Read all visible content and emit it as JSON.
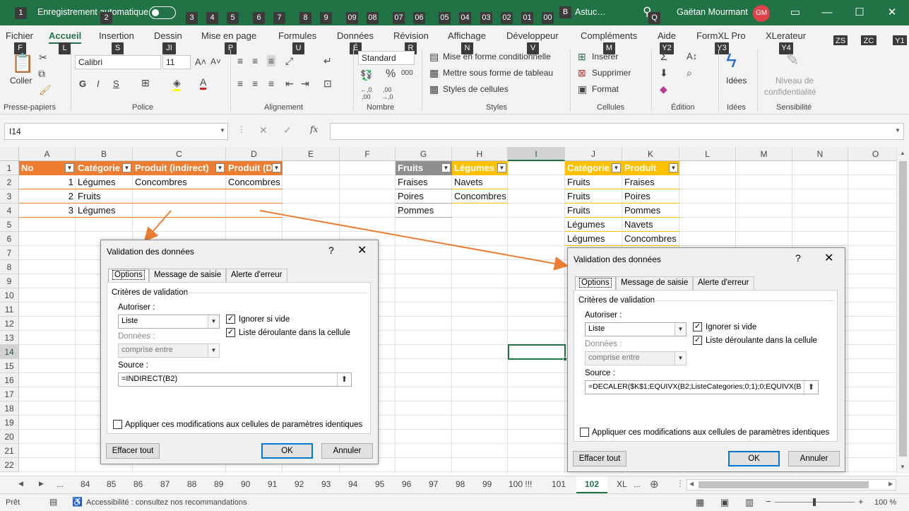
{
  "title_bar": {
    "autosave_label": "Enregistrement automatique",
    "qat_keys": [
      "1",
      "2",
      "3",
      "4",
      "5",
      "6",
      "7",
      "8",
      "9",
      "09",
      "08",
      "07",
      "06",
      "05",
      "04",
      "03",
      "02",
      "01",
      "00"
    ],
    "search_key": "B",
    "search_text": "Astuc…",
    "search_hint_key": "Q",
    "user_name": "Gaëtan Mourmant",
    "user_initials": "GM"
  },
  "tabs": [
    {
      "label": "Fichier",
      "key": "F"
    },
    {
      "label": "Accueil",
      "key": "L"
    },
    {
      "label": "Insertion",
      "key": "S"
    },
    {
      "label": "Dessin",
      "key": "JI"
    },
    {
      "label": "Mise en page",
      "key": "P"
    },
    {
      "label": "Formules",
      "key": "U"
    },
    {
      "label": "Données",
      "key": "É"
    },
    {
      "label": "Révision",
      "key": "R"
    },
    {
      "label": "Affichage",
      "key": "N"
    },
    {
      "label": "Développeur",
      "key": "V"
    },
    {
      "label": "Compléments",
      "key": "M"
    },
    {
      "label": "Aide",
      "key": "Y2"
    },
    {
      "label": "FormXL Pro",
      "key": "Y3"
    },
    {
      "label": "XLerateur",
      "key": "Y4"
    }
  ],
  "tab_extra_keys": [
    "ZS",
    "ZC",
    "Y1"
  ],
  "ribbon": {
    "clipboard": {
      "paste": "Coller",
      "group": "Presse-papiers"
    },
    "font": {
      "name": "Calibri",
      "size": "11",
      "bold": "G",
      "italic": "I",
      "underline": "S",
      "group": "Police"
    },
    "alignment": {
      "group": "Alignement"
    },
    "number": {
      "format": "Standard",
      "group": "Nombre"
    },
    "styles": {
      "conditional": "Mise en forme conditionnelle",
      "table": "Mettre sous forme de tableau",
      "cell_styles": "Styles de cellules",
      "group": "Styles"
    },
    "cells": {
      "insert": "Insérer",
      "delete": "Supprimer",
      "format": "Format",
      "group": "Cellules"
    },
    "editing": {
      "group": "Édition"
    },
    "ideas": {
      "label": "Idées",
      "group": "Idées"
    },
    "sensitivity": {
      "label1": "Niveau de",
      "label2": "confidentialité",
      "group": "Sensibilité"
    }
  },
  "formula_bar": {
    "name_box": "I14",
    "formula": "",
    "fx": "fx"
  },
  "columns": [
    "A",
    "B",
    "C",
    "D",
    "E",
    "F",
    "G",
    "H",
    "I",
    "J",
    "K",
    "L",
    "M",
    "N",
    "O"
  ],
  "rows": [
    "1",
    "2",
    "3",
    "4",
    "5",
    "6",
    "7",
    "8",
    "9",
    "10",
    "11",
    "12",
    "13",
    "14",
    "15",
    "16",
    "17",
    "18",
    "19",
    "20",
    "21",
    "22"
  ],
  "table1": {
    "headers": [
      "No",
      "Catégorie",
      "Produit (indirect)",
      "Produit (D"
    ],
    "rows": [
      [
        "1",
        "Légumes",
        "Concombres",
        "Concombres"
      ],
      [
        "2",
        "Fruits",
        "",
        ""
      ],
      [
        "3",
        "Légumes",
        "",
        ""
      ]
    ]
  },
  "table2": {
    "headers": [
      "Fruits",
      "Légumes"
    ],
    "rows": [
      [
        "Fraises",
        "Navets"
      ],
      [
        "Poires",
        "Concombres"
      ],
      [
        "Pommes",
        ""
      ]
    ]
  },
  "table3": {
    "headers": [
      "Catégorie",
      "Produit"
    ],
    "rows": [
      [
        "Fruits",
        "Fraises"
      ],
      [
        "Fruits",
        "Poires"
      ],
      [
        "Fruits",
        "Pommes"
      ],
      [
        "Légumes",
        "Navets"
      ],
      [
        "Légumes",
        "Concombres"
      ]
    ]
  },
  "dialog1": {
    "title": "Validation des données",
    "help": "?",
    "close": "✕",
    "tabs": [
      "Options",
      "Message de saisie",
      "Alerte d'erreur"
    ],
    "criteria": "Critères de validation",
    "allow_label": "Autoriser :",
    "allow_value": "Liste",
    "data_label": "Données :",
    "data_value": "comprise entre",
    "ignore_blank": "Ignorer si vide",
    "in_cell_dropdown": "Liste déroulante dans la cellule",
    "source_label": "Source :",
    "source_value": "=INDIRECT(B2)",
    "apply_all": "Appliquer ces modifications aux cellules de paramètres identiques",
    "clear": "Effacer tout",
    "ok": "OK",
    "cancel": "Annuler"
  },
  "dialog2": {
    "title": "Validation des données",
    "help": "?",
    "close": "✕",
    "tabs": [
      "Options",
      "Message de saisie",
      "Alerte d'erreur"
    ],
    "criteria": "Critères de validation",
    "allow_label": "Autoriser :",
    "allow_value": "Liste",
    "data_label": "Données :",
    "data_value": "comprise entre",
    "ignore_blank": "Ignorer si vide",
    "in_cell_dropdown": "Liste déroulante dans la cellule",
    "source_label": "Source :",
    "source_value": "=DECALER($K$1;EQUIVX(B2;ListeCategories;0;1);0;EQUIVX(B",
    "apply_all": "Appliquer ces modifications aux cellules de paramètres identiques",
    "clear": "Effacer tout",
    "ok": "OK",
    "cancel": "Annuler"
  },
  "sheet_tabs": [
    "...",
    "84",
    "85",
    "86",
    "87",
    "88",
    "89",
    "90",
    "91",
    "92",
    "93",
    "94",
    "95",
    "96",
    "97",
    "98",
    "99",
    "100 !!!",
    "101",
    "102",
    "XL",
    "..."
  ],
  "active_sheet": "102",
  "status": {
    "ready": "Prêt",
    "accessibility": "Accessibilité : consultez nos recommandations",
    "zoom": "100 %"
  },
  "colors": {
    "excel_green": "#217346",
    "orange": "#ed7d31",
    "gray": "#8f8f8f",
    "gold": "#ffc000",
    "arrow": "#ed7d31"
  }
}
